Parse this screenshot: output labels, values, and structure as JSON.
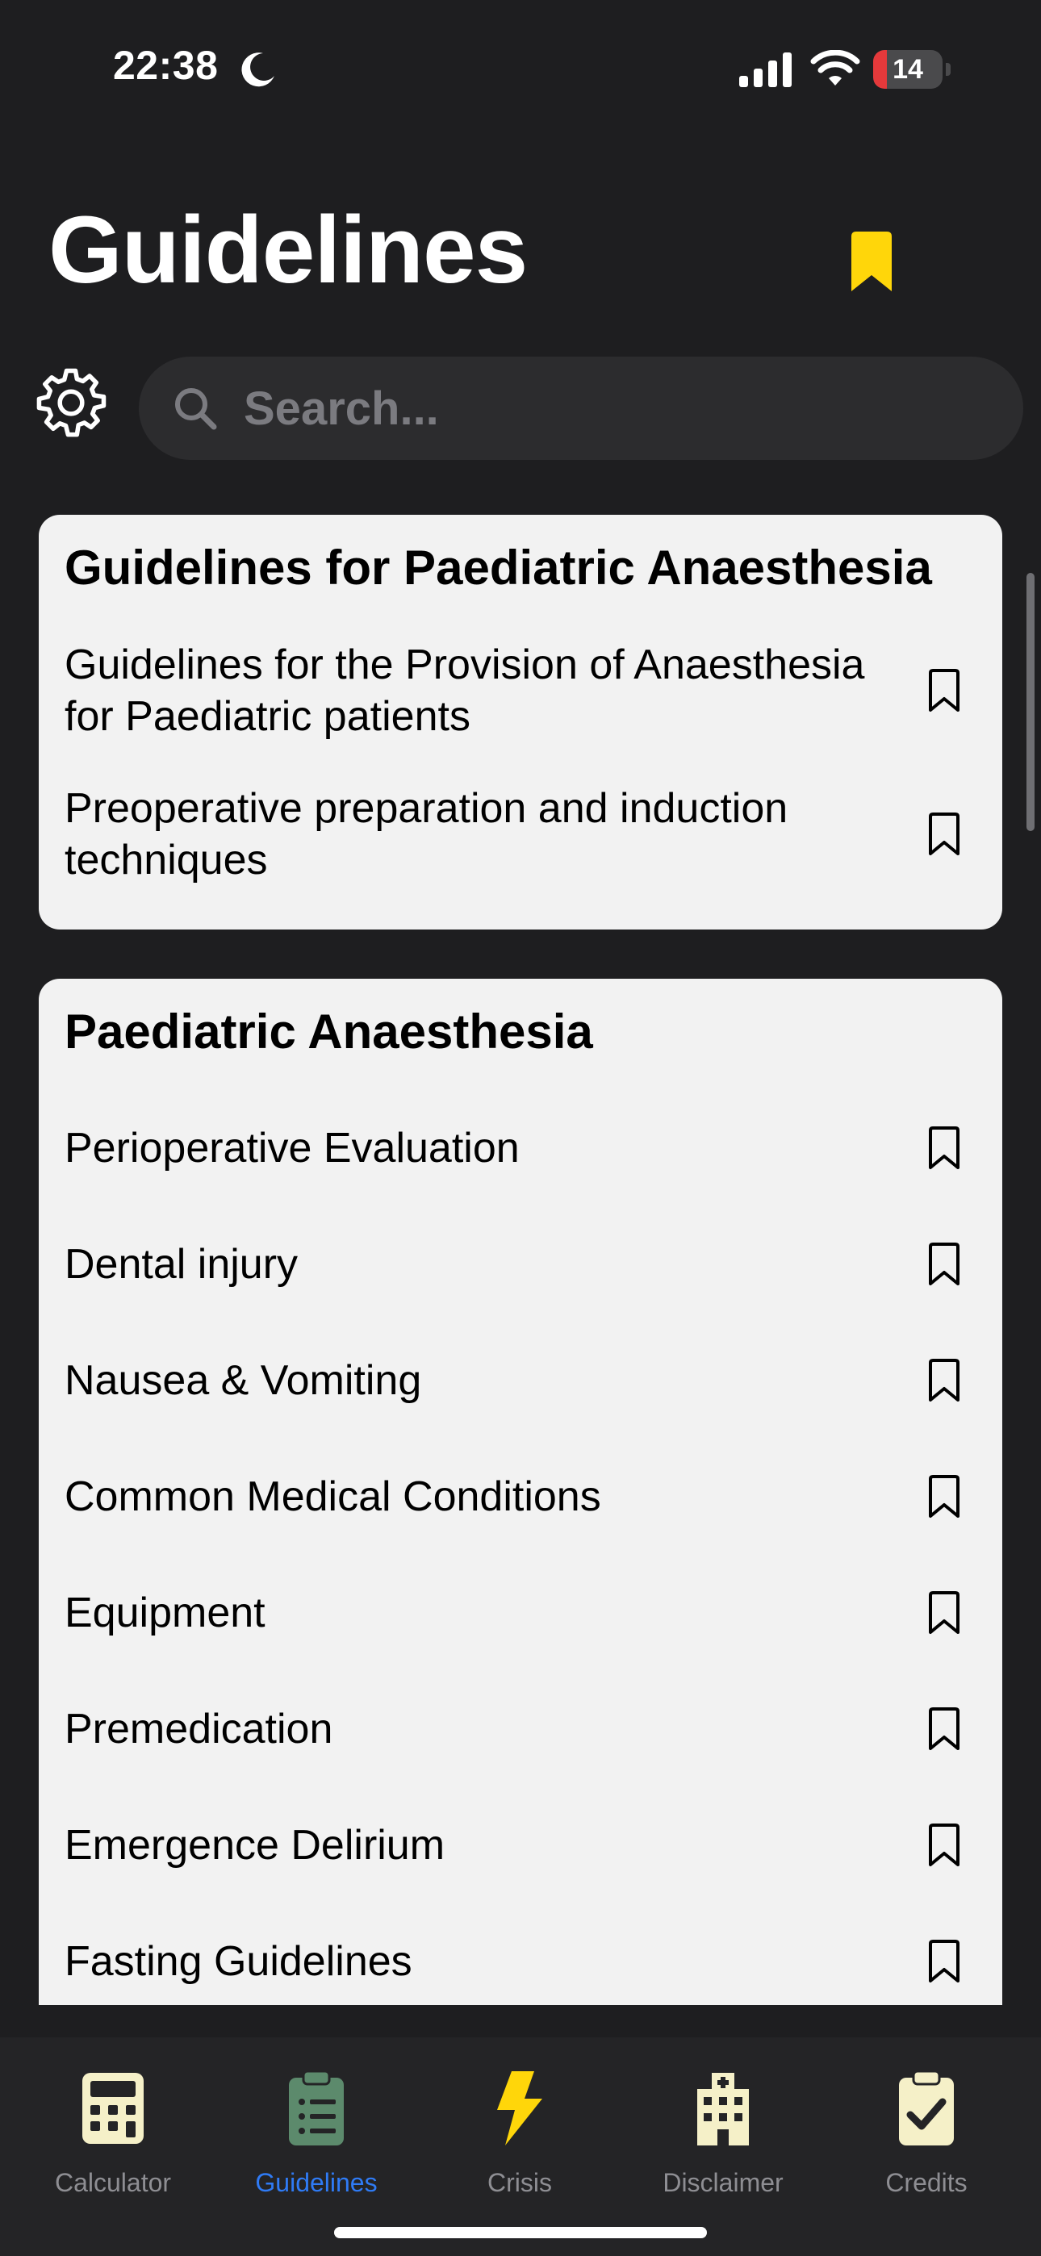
{
  "status_bar": {
    "time": "22:38",
    "battery_level": "14",
    "battery_fraction": 0.14,
    "icons": [
      "moon-icon",
      "cellular-signal-icon",
      "wifi-icon",
      "battery-icon"
    ]
  },
  "header": {
    "title": "Guidelines",
    "bookmarks_icon": "bookmark-filled-icon",
    "bookmarks_color": "#ffd60a"
  },
  "search": {
    "placeholder": "Search...",
    "value": "",
    "settings_icon": "gear-icon",
    "search_icon": "magnifier-icon"
  },
  "sections": [
    {
      "title": "Guidelines for Paediatric Anaesthesia",
      "items": [
        {
          "label": "Guidelines for the Provision of Anaesthesia for Paediatric patients",
          "bookmarked": false
        },
        {
          "label": "Preoperative preparation and induction techniques",
          "bookmarked": false
        }
      ]
    },
    {
      "title": "Paediatric Anaesthesia",
      "items": [
        {
          "label": "Perioperative Evaluation",
          "bookmarked": false
        },
        {
          "label": "Dental injury",
          "bookmarked": false
        },
        {
          "label": "Nausea & Vomiting",
          "bookmarked": false
        },
        {
          "label": "Common Medical Conditions",
          "bookmarked": false
        },
        {
          "label": "Equipment",
          "bookmarked": false
        },
        {
          "label": "Premedication",
          "bookmarked": false
        },
        {
          "label": "Emergence Delirium",
          "bookmarked": false
        },
        {
          "label": "Fasting Guidelines",
          "bookmarked": false
        }
      ]
    }
  ],
  "tab_bar": {
    "active_tab": "Guidelines",
    "active_color": "#2f7bf5",
    "tabs": [
      {
        "label": "Calculator",
        "icon": "calculator-icon",
        "icon_color": "#f5f0c8"
      },
      {
        "label": "Guidelines",
        "icon": "clipboard-list-icon",
        "icon_color": "#5c8a6c"
      },
      {
        "label": "Crisis",
        "icon": "lightning-bolt-icon",
        "icon_color": "#ffd60a"
      },
      {
        "label": "Disclaimer",
        "icon": "hospital-building-icon",
        "icon_color": "#f5f0c8"
      },
      {
        "label": "Credits",
        "icon": "clipboard-check-icon",
        "icon_color": "#f5f0c8"
      }
    ]
  }
}
